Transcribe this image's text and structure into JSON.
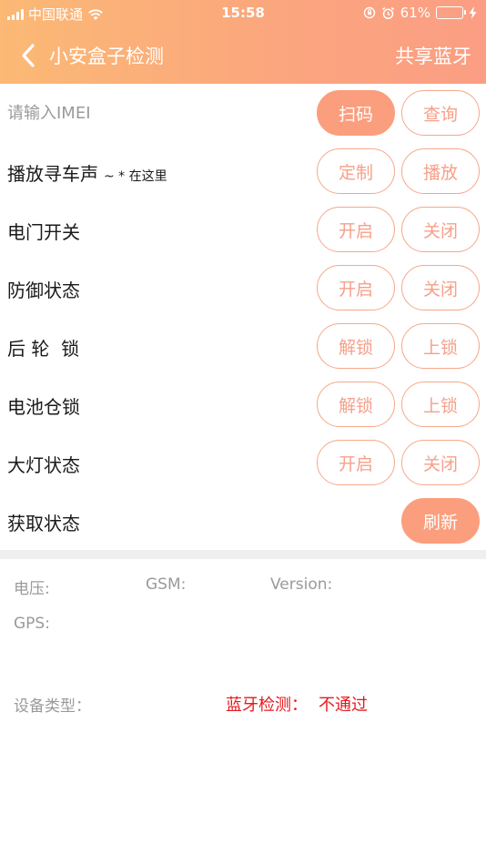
{
  "status_bar": {
    "carrier": "中国联通",
    "time": "15:58",
    "battery_percent": "61%",
    "battery_level": 0.61,
    "battery_color": "#4cd964"
  },
  "nav": {
    "title": "小安盒子检测",
    "right_action": "共享蓝牙",
    "back_icon": "chevron-left-icon"
  },
  "imei": {
    "placeholder": "请输入IMEI",
    "value": "",
    "scan_label": "扫码",
    "query_label": "查询"
  },
  "controls": [
    {
      "label": "播放寻车声",
      "sub": "~ * 在这里",
      "btn1": "定制",
      "btn2": "播放"
    },
    {
      "label": "电门开关",
      "btn1": "开启",
      "btn2": "关闭"
    },
    {
      "label": "防御状态",
      "btn1": "开启",
      "btn2": "关闭"
    },
    {
      "label": "后 轮  锁",
      "btn1": "解锁",
      "btn2": "上锁"
    },
    {
      "label": "电池仓锁",
      "btn1": "解锁",
      "btn2": "上锁"
    },
    {
      "label": "大灯状态",
      "btn1": "开启",
      "btn2": "关闭"
    }
  ],
  "status_row": {
    "label": "获取状态",
    "refresh_label": "刷新"
  },
  "info": {
    "voltage_label": "电压:",
    "gsm_label": "GSM:",
    "version_label": "Version:",
    "gps_label": "GPS:",
    "device_type_label": "设备类型："
  },
  "bluetooth_check": {
    "label": "蓝牙检测：",
    "result": "不通过"
  },
  "colors": {
    "accent": "#fb9e7e",
    "header_start": "#fbb975",
    "header_end": "#fb9e84",
    "error": "#e8171d"
  }
}
